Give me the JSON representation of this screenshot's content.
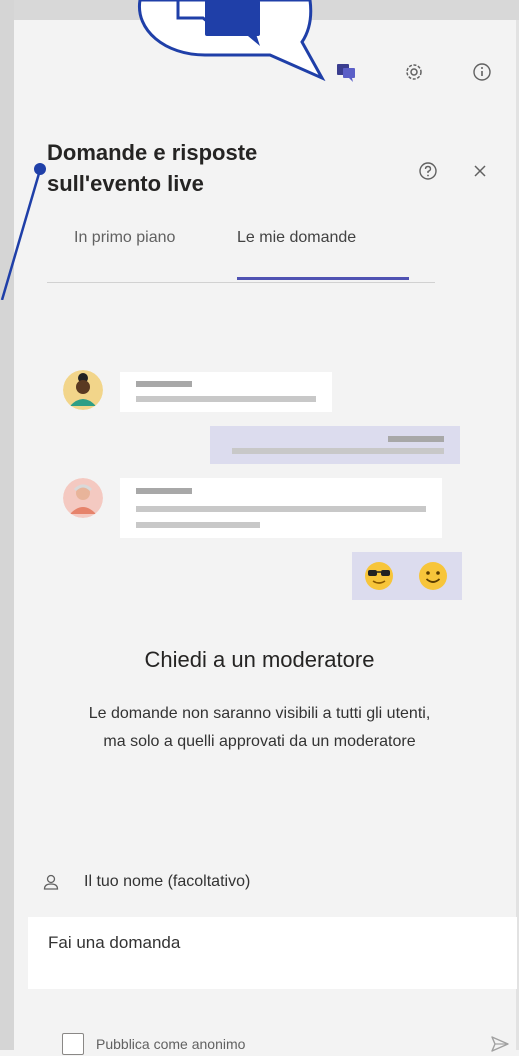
{
  "panel": {
    "title_line1": "Domande e risposte",
    "title_line2": "sull'evento live"
  },
  "toolbar": {
    "icons": [
      "qa-chat-icon",
      "gear-icon",
      "info-icon"
    ]
  },
  "tabs": [
    {
      "label": "In primo piano",
      "selected": false
    },
    {
      "label": "Le mie domande",
      "selected": true
    }
  ],
  "empty_state": {
    "heading": "Chiedi a un moderatore",
    "description_line1": "Le domande non saranno visibili a tutti gli utenti,",
    "description_line2": "ma solo a quelli approvati da un moderatore"
  },
  "form": {
    "name_label": "Il tuo nome (facoltativo)",
    "question_placeholder": "Fai una domanda",
    "anonymous_label": "Pubblica come anonimo",
    "anonymous_checked": false
  },
  "colors": {
    "accent": "#4f52b2",
    "callout": "#1f3fa8",
    "panel_bg": "#f3f3f3"
  }
}
